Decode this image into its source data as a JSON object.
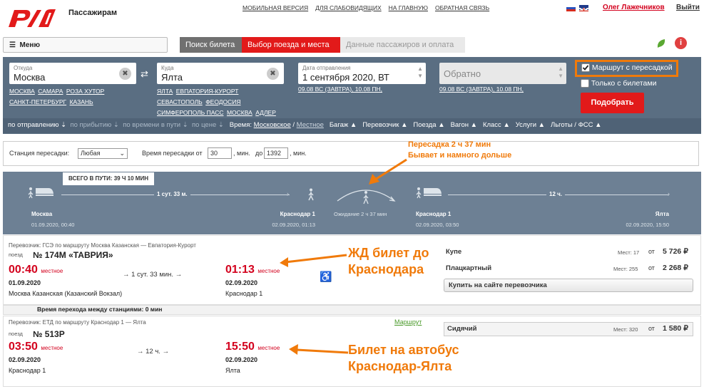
{
  "header": {
    "brand": "Пассажирам",
    "links": [
      "МОБИЛЬНАЯ ВЕРСИЯ",
      "ДЛЯ СЛАБОВИДЯЩИХ",
      "НА ГЛАВНУЮ",
      "ОБРАТНАЯ СВЯЗЬ"
    ],
    "user": "Олег Лажечников",
    "exit": "Выйти",
    "colors": {
      "brand_red": "#e21a1a",
      "panel": "#5a6e82",
      "accent_orange": "#f07a0a"
    }
  },
  "nav": {
    "menu": "Меню",
    "steps": [
      "Поиск билета",
      "Выбор поезда и места",
      "Данные пассажиров и оплата"
    ],
    "info_icon": "i"
  },
  "search": {
    "from_label": "Откуда",
    "from_value": "Москва",
    "from_quick": [
      "МОСКВА",
      "САМАРА",
      "РОЗА ХУТОР",
      "САНКТ-ПЕТЕРБУРГ",
      "КАЗАНЬ"
    ],
    "to_label": "Куда",
    "to_value": "Ялта",
    "to_quick": [
      "ЯЛТА",
      "ЕВПАТОРИЯ-КУРОРТ",
      "СЕВАСТОПОЛЬ",
      "ФЕОДОСИЯ",
      "СИМФЕРОПОЛЬ ПАСС",
      "МОСКВА",
      "АДЛЕР"
    ],
    "date_label": "Дата отправления",
    "date_value": "1 сентября 2020, ВТ",
    "date_quick": "09.08 ВС (завтра), 10.08 ПН,",
    "return_value": "Обратно",
    "return_quick": "09.08 ВС (завтра), 10.08 ПН,",
    "transfer_route": "Маршрут с пересадкой",
    "only_tickets": "Только с билетами",
    "find": "Подобрать"
  },
  "sortbar": {
    "sort": [
      "по отправлению",
      "по прибытию",
      "по времени в пути",
      "по цене"
    ],
    "time_label": "Время:",
    "time_moscow": "Московское",
    "time_local": "Местное",
    "filters": [
      "Багаж",
      "Перевозчик",
      "Поезда",
      "Вагон",
      "Класс",
      "Услуги",
      "Льготы / ФСС"
    ]
  },
  "filter": {
    "station_label": "Станция пересадки:",
    "station_value": "Любая",
    "time_label": "Время пересадки от",
    "from": "30",
    "min1": ", мин.",
    "to_label": "до",
    "to": "1392",
    "min2": ", мин."
  },
  "annotations": {
    "transfer_line1": "Пересадка 2 ч 37 мин",
    "transfer_line2": "Бывает и намного дольше",
    "train_line1": "ЖД билет до",
    "train_line2": "Краснодара",
    "bus_line1": "Билет на автобус",
    "bus_line2": "Краснодар-Ялта"
  },
  "route": {
    "total": "ВСЕГО В ПУТИ: 39 Ч 10 МИН",
    "seg1_dur": "1 сут. 33 м.",
    "seg2_dur": "12 ч.",
    "wait": "Ожидание 2 ч 37 мин",
    "points": [
      {
        "name": "Москва",
        "dt": "01.09.2020, 00:40"
      },
      {
        "name": "Краснодар 1",
        "dt": "02.09.2020, 01:13"
      },
      {
        "name": "Краснодар 1",
        "dt": "02.09.2020, 03:50"
      },
      {
        "name": "Ялта",
        "dt": "02.09.2020, 15:50"
      }
    ]
  },
  "train1": {
    "carrier": "Перевозчик: ГСЭ   по маршруту Москва Казанская — Евпатория-Курорт",
    "kind": "поезд",
    "number": "№ 174М «ТАВРИЯ»",
    "dep_time": "00:40",
    "dep_suffix": "местное",
    "dep_date": "01.09.2020",
    "dep_station": "Москва Казанская (Казанский Вокзал)",
    "duration": "→ 1 сут. 33 мин. →",
    "arr_time": "01:13",
    "arr_suffix": "местное",
    "arr_date": "02.09.2020",
    "arr_station": "Краснодар 1",
    "classes": [
      {
        "name": "Купе",
        "seats": "Мест: 17",
        "ot": "от",
        "price": "5 726 ₽"
      },
      {
        "name": "Плацкартный",
        "seats": "Мест: 255",
        "ot": "от",
        "price": "2 268 ₽"
      }
    ],
    "buy": "Купить на сайте перевозчика"
  },
  "transfer_note": "Время перехода между станциями: 0 мин",
  "train2": {
    "carrier": "Перевозчик: ЕТД   по маршруту Краснодар 1 — Ялта",
    "route_link": "Маршрут",
    "kind": "поезд",
    "number": "№ 513Р",
    "dep_time": "03:50",
    "dep_suffix": "местное",
    "dep_date": "02.09.2020",
    "dep_station": "Краснодар 1",
    "duration": "→ 12 ч. →",
    "arr_time": "15:50",
    "arr_suffix": "местное",
    "arr_date": "02.09.2020",
    "arr_station": "Ялта",
    "classes": [
      {
        "name": "Сидячий",
        "seats": "Мест: 320",
        "ot": "от",
        "price": "1 580 ₽"
      }
    ]
  }
}
